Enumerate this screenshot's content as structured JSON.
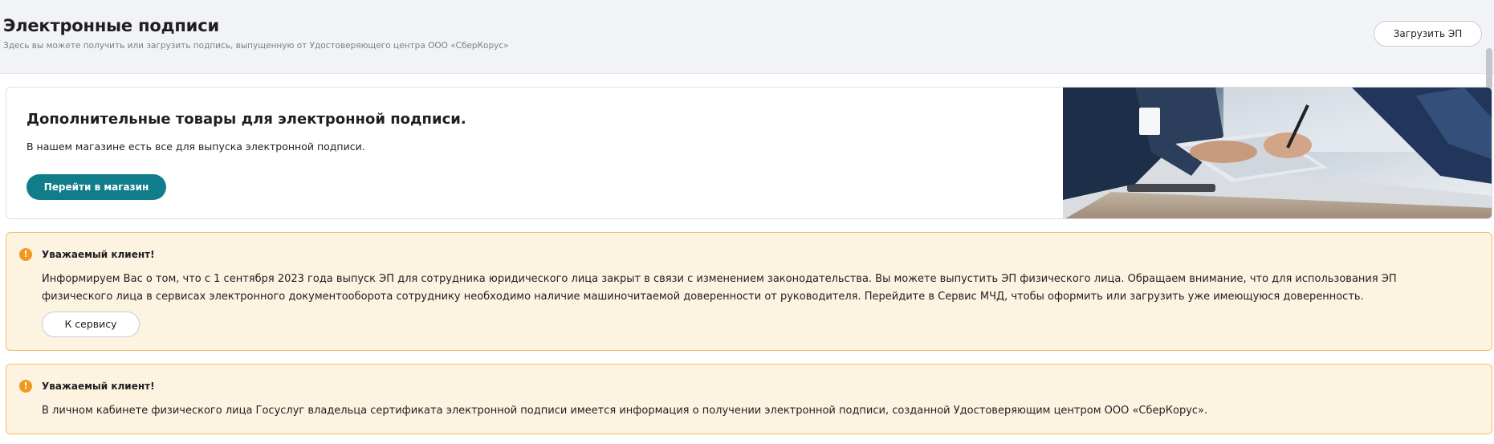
{
  "header": {
    "title": "Электронные подписи",
    "subtitle": "Здесь вы можете получить или загрузить подпись, выпущенную от Удостоверяющего центра ООО «СберКорус»",
    "upload_button": "Загрузить ЭП"
  },
  "promo": {
    "title": "Дополнительные товары для электронной подписи.",
    "text": "В нашем магазине есть все для выпуска электронной подписи.",
    "button": "Перейти в магазин"
  },
  "notices": [
    {
      "title": "Уважаемый клиент!",
      "text": "Информируем Вас о том, что с 1 сентября 2023 года выпуск ЭП для сотрудника юридического лица закрыт в связи с изменением законодательства. Вы можете выпустить ЭП физического лица. Обращаем внимание, что для использования ЭП физического лица в сервисах электронного документооборота сотруднику необходимо наличие машиночитаемой доверенности от руководителя. Перейдите в Сервис МЧД, чтобы оформить или загрузить уже имеющуюся доверенность.",
      "button": "К сервису"
    },
    {
      "title": "Уважаемый клиент!",
      "text": "В личном кабинете физического лица Госуслуг владельца сертификата электронной подписи имеется информация о получении электронной подписи, созданной Удостоверяющим центром ООО «СберКорус»."
    }
  ],
  "colors": {
    "accent": "#127d8a",
    "notice_bg": "#fdf3e1",
    "notice_border": "#f4bf6a",
    "warning_icon": "#f29a1f"
  }
}
